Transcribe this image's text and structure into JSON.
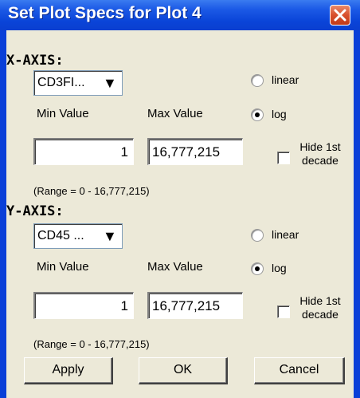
{
  "window": {
    "title": "Set Plot Specs for Plot 4"
  },
  "x_axis": {
    "heading": "X-AXIS:",
    "parameter": "CD3FI...",
    "linear_label": "linear",
    "log_label": "log",
    "scale_selected": "log",
    "min_label": "Min Value",
    "max_label": "Max Value",
    "min_value": "1",
    "max_value": "16,777,215",
    "hide_label_1": "Hide 1st",
    "hide_label_2": "decade",
    "hide_checked": false,
    "range_text": "(Range = 0 - 16,777,215)"
  },
  "y_axis": {
    "heading": "Y-AXIS:",
    "parameter": "CD45 ...",
    "linear_label": "linear",
    "log_label": "log",
    "scale_selected": "log",
    "min_label": "Min Value",
    "max_label": "Max Value",
    "min_value": "1",
    "max_value": "16,777,215",
    "hide_label_1": "Hide 1st",
    "hide_label_2": "decade",
    "hide_checked": false,
    "range_text": "(Range = 0 - 16,777,215)"
  },
  "buttons": {
    "apply": "Apply",
    "ok": "OK",
    "cancel": "Cancel"
  },
  "icons": {
    "close": "close-icon",
    "dropdown": "dropdown-arrow-icon"
  },
  "colors": {
    "titlebar": "#0a44d8",
    "close_button": "#d8502d",
    "dialog_bg": "#ece9d8"
  }
}
